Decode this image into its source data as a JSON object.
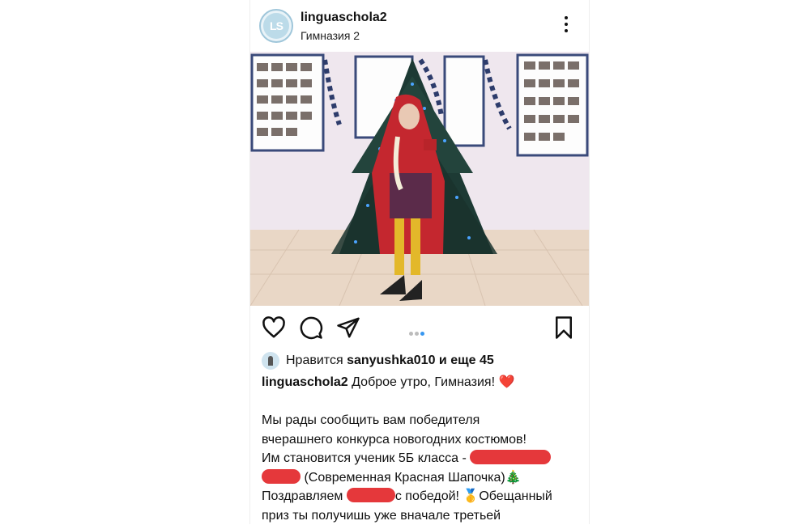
{
  "post": {
    "username": "linguaschola2",
    "location": "Гимназия 2",
    "avatar_text": "LS",
    "carousel": {
      "count": 3,
      "active": 2
    },
    "likes": {
      "prefix": "Нравится",
      "user": "sanyushka010",
      "suffix": "и еще 45"
    },
    "caption": {
      "username": "linguaschola2",
      "greeting": "Доброе утро, Гимназия! ❤️",
      "line1": "Мы рады сообщить вам победителя",
      "line2": "вчерашнего конкурса новогодних костюмов!",
      "line3": "Им становится ученик 5Б класса -",
      "line4": "(Современная Красная Шапочка)🎄",
      "line5a": "Поздравляем",
      "line5b": "с победой! 🥇Обещанный",
      "line6": "приз ты получишь уже вначале третьей"
    }
  },
  "icons": [
    "heart-icon",
    "comment-icon",
    "share-icon",
    "bookmark-icon",
    "more-icon"
  ],
  "colors": {
    "accent": "#3797f0",
    "redaction": "#e5383b"
  }
}
